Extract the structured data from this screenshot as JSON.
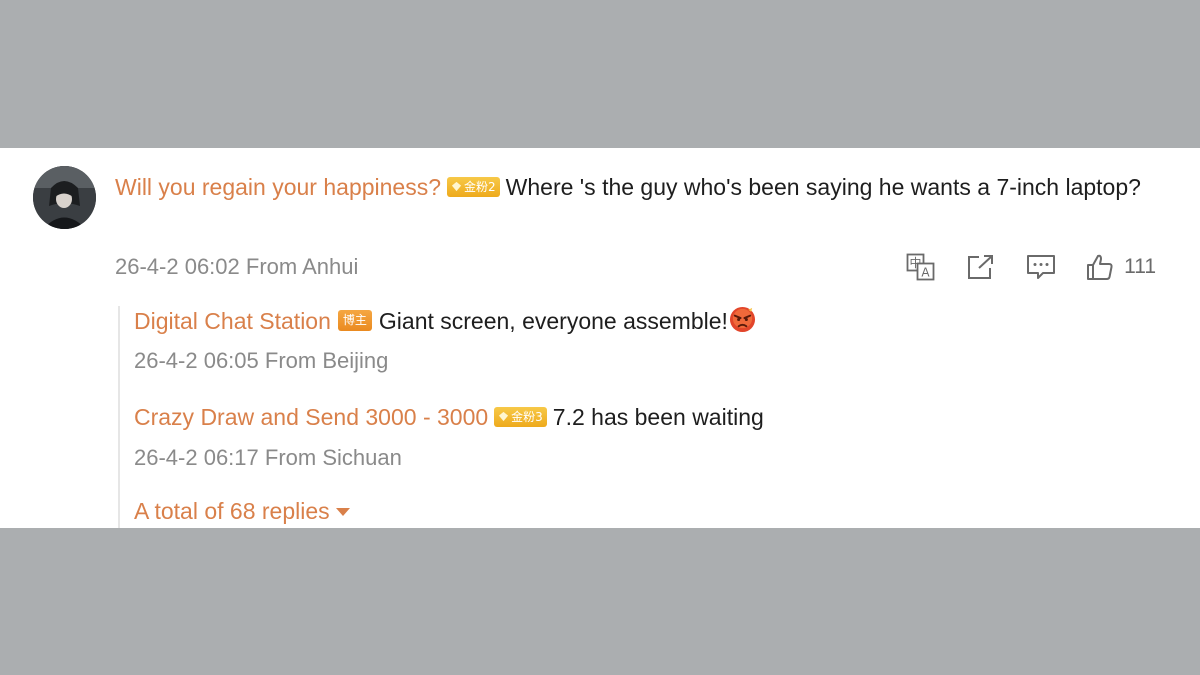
{
  "comment": {
    "username": "Will you regain your happiness?",
    "badge_label": "金粉2",
    "text": "Where 's the guy who's been saying he wants a 7-inch laptop?",
    "timestamp": "26-4-2 06:02",
    "location": "From Anhui",
    "likes": "111",
    "actions": [
      "translate-icon",
      "share-icon",
      "comment-icon",
      "like-icon"
    ]
  },
  "replies": [
    {
      "username": "Digital Chat Station",
      "badge_label": "博主",
      "text": "Giant screen, everyone assemble!",
      "emoji": "angry-face-emoji",
      "timestamp": "26-4-2 06:05",
      "location": "From Beijing"
    },
    {
      "username": "Crazy Draw and Send 3000 - 3000",
      "badge_label": "金粉3",
      "text": "7.2 has been waiting",
      "timestamp": "26-4-2 06:17",
      "location": "From Sichuan"
    }
  ],
  "more_replies_label": "A total of 68 replies",
  "colors": {
    "username": "#d9804a",
    "meta": "#8a8a8a",
    "gold_badge": "#f2b52c",
    "host_badge": "#ee9430",
    "background": "#abaeb0"
  }
}
